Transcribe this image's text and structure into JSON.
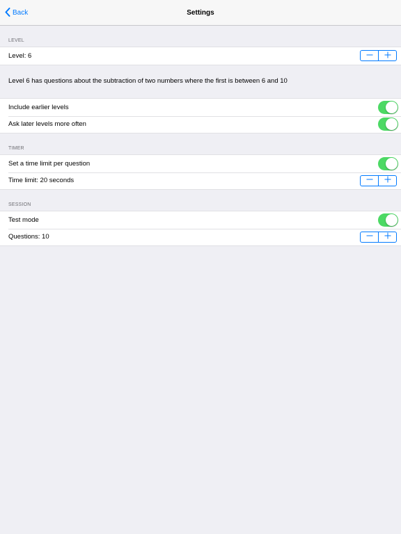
{
  "navbar": {
    "back_label": "Back",
    "title": "Settings"
  },
  "colors": {
    "accent": "#007aff",
    "toggle_on": "#4cd964",
    "background": "#efeff4"
  },
  "sections": {
    "level": {
      "header": "LEVEL",
      "level_row": {
        "label": "Level: 6",
        "value": 6
      },
      "description": "Level 6 has questions about the subtraction of two numbers where the first is between 6 and 10",
      "include_earlier": {
        "label": "Include earlier levels",
        "on": true
      },
      "ask_later": {
        "label": "Ask later levels more often",
        "on": true
      }
    },
    "timer": {
      "header": "TIMER",
      "time_limit_toggle": {
        "label": "Set a time limit per question",
        "on": true
      },
      "time_limit_row": {
        "label": "Time limit: 20 seconds",
        "value": 20
      }
    },
    "session": {
      "header": "SESSION",
      "test_mode": {
        "label": "Test mode",
        "on": true
      },
      "questions_row": {
        "label": "Questions: 10",
        "value": 10
      }
    }
  },
  "icons": {
    "back": "chevron-left-icon",
    "minus": "minus-icon",
    "plus": "plus-icon"
  }
}
